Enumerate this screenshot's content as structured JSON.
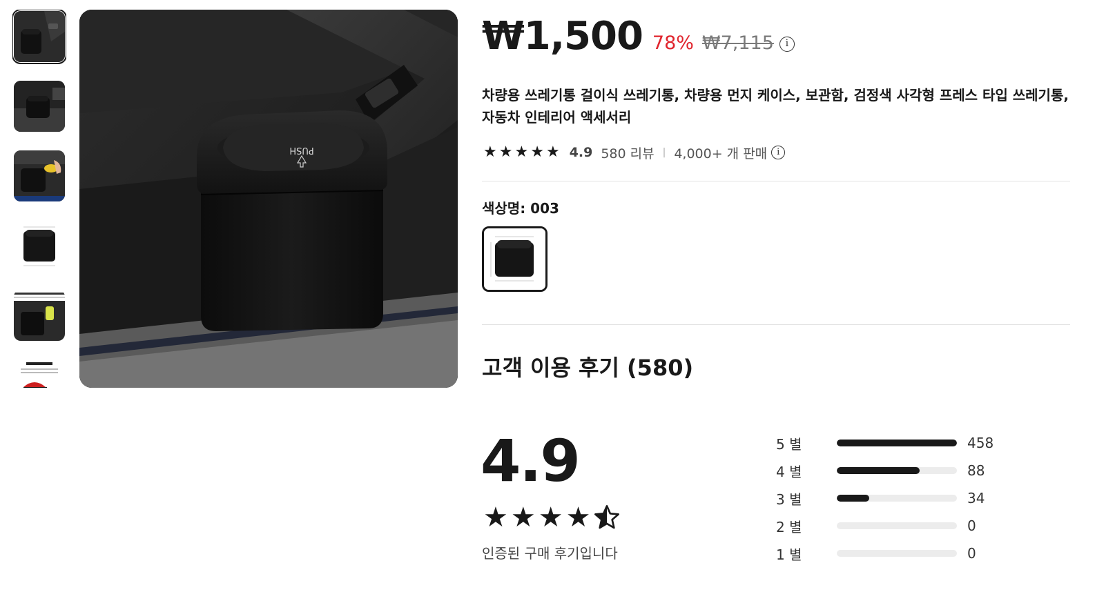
{
  "product": {
    "price": "₩1,500",
    "discount": "78%",
    "original_price": "₩7,115",
    "title": "차량용 쓰레기통 걸이식 쓰레기통, 차량용 먼지 케이스, 보관함, 검정색 사각형 프레스 타입 쓰레기통, 자동차 인테리어 액세서리",
    "rating": "4.9",
    "review_count": "580 리뷰",
    "sold": "4,000+ 개 판매",
    "color_label": "색상명: 003",
    "image_text": "PUSH"
  },
  "thumbnails": [
    {
      "name": "thumb-1"
    },
    {
      "name": "thumb-2"
    },
    {
      "name": "thumb-3"
    },
    {
      "name": "thumb-4"
    },
    {
      "name": "thumb-5",
      "caption": "Changing travel is not just trash can"
    },
    {
      "name": "thumb-6",
      "caption": "TOP FLAP DESIGN"
    }
  ],
  "reviews": {
    "title": "고객 이용 후기 (580)",
    "average": "4.9",
    "average_stars": 4.9,
    "verified_text": "인증된 구매 후기입니다",
    "distribution": [
      {
        "label": "5 별",
        "count": "458",
        "fraction": 1.0
      },
      {
        "label": "4 별",
        "count": "88",
        "fraction": 0.69
      },
      {
        "label": "3 별",
        "count": "34",
        "fraction": 0.27
      },
      {
        "label": "2 별",
        "count": "0",
        "fraction": 0
      },
      {
        "label": "1 별",
        "count": "0",
        "fraction": 0
      }
    ]
  },
  "colors": {
    "text": "#191919",
    "discount": "#e0242d",
    "muted": "#7a7a7a",
    "bar_track": "#ececec"
  },
  "icons": [
    "info-icon",
    "star-icon",
    "half-star-icon"
  ]
}
